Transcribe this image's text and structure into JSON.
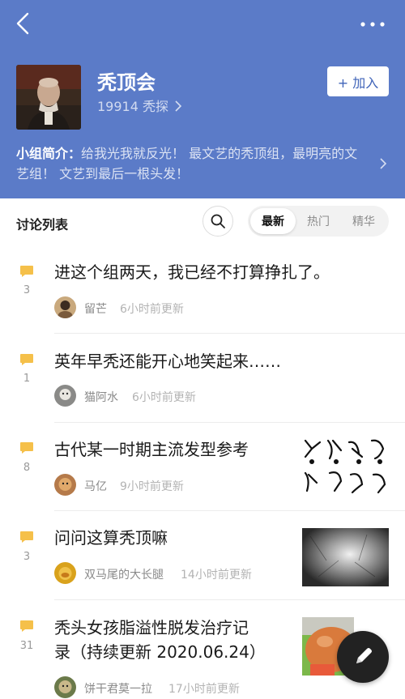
{
  "header": {
    "group_name": "秃顶会",
    "member_count": "19914",
    "member_unit": "秃探",
    "join_label": "+ 加入",
    "intro_label": "小组简介：",
    "intro_text": "给我光我就反光！ 最文艺的秃顶组，最明亮的文艺组！ 文艺到最后一根头发！",
    "bg_color": "#5b7bc8"
  },
  "icons": {
    "back": "back-arrow-icon",
    "more": "more-dots-icon",
    "search": "search-icon",
    "comment": "comment-bubble-icon",
    "compose": "pencil-icon"
  },
  "list": {
    "title": "讨论列表",
    "tabs": [
      "最新",
      "热门",
      "精华"
    ],
    "active_tab": "最新"
  },
  "posts": [
    {
      "count": "3",
      "title": "进这个组两天，我已经不打算挣扎了。",
      "author": "留芒",
      "time": "6小时前更新",
      "has_thumb": false
    },
    {
      "count": "1",
      "title": "英年早秃还能开心地笑起来……",
      "author": "猫阿水",
      "time": "6小时前更新",
      "has_thumb": false
    },
    {
      "count": "8",
      "title": "古代某一时期主流发型参考",
      "author": "马亿",
      "time": "9小时前更新",
      "has_thumb": true
    },
    {
      "count": "3",
      "title": "问问这算秃顶嘛",
      "author": "双马尾的大长腿",
      "time": "14小时前更新",
      "has_thumb": true
    },
    {
      "count": "31",
      "title_line1": "秃头女孩脂溢性脱发治疗记",
      "title_line2": "录（持续更新 2020.06.24）",
      "author": "饼干君莫一拉",
      "time": "17小时前更新",
      "has_thumb": true
    }
  ],
  "accent_color": "#f5c04a"
}
